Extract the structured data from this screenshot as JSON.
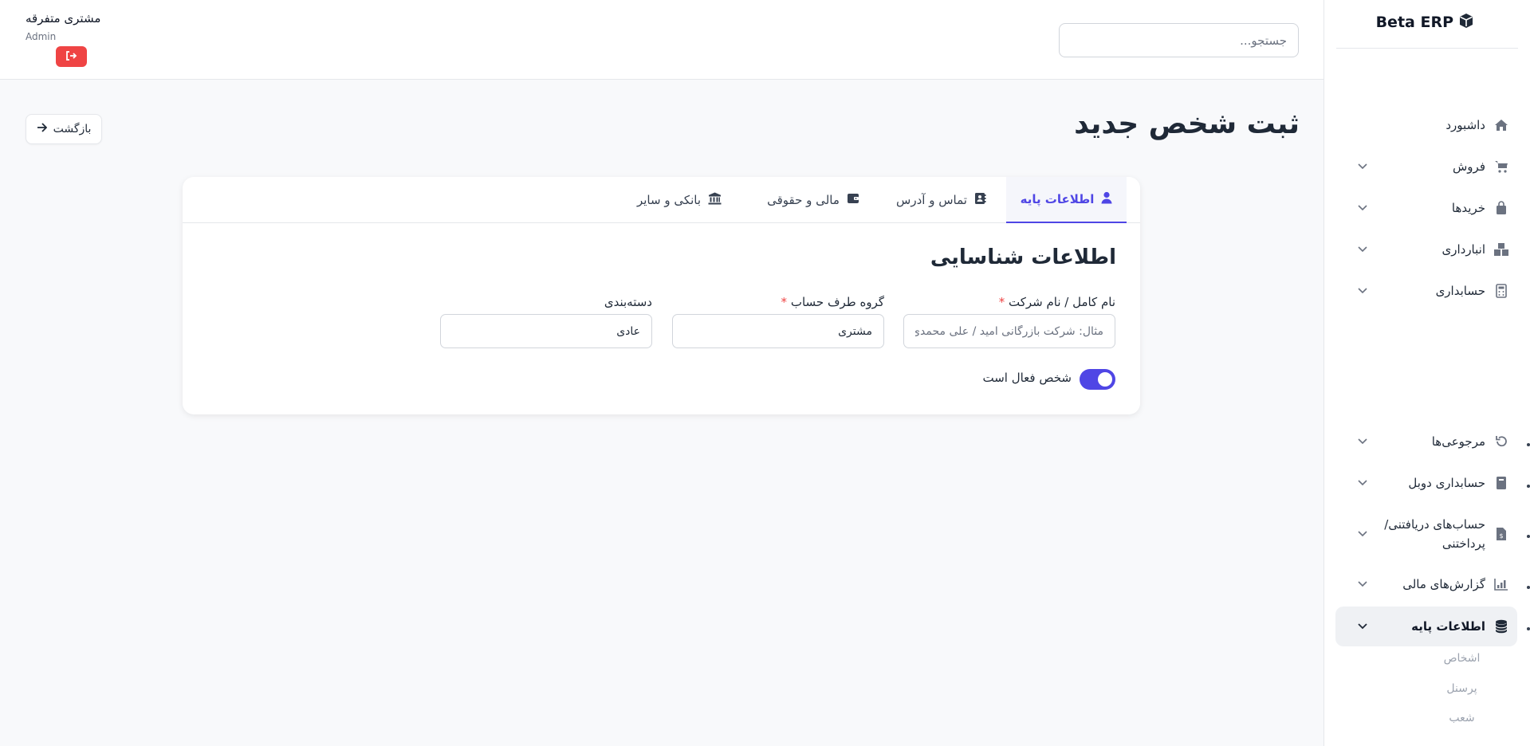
{
  "brand": {
    "name": "Beta ERP"
  },
  "sidebar": {
    "items": [
      {
        "label": "داشبورد",
        "icon": "home-icon"
      },
      {
        "label": "فروش",
        "icon": "cart-icon"
      },
      {
        "label": "خریدها",
        "icon": "bag-icon"
      },
      {
        "label": "انبارداری",
        "icon": "boxes-icon"
      },
      {
        "label": "حسابداری",
        "icon": "calculator-icon"
      },
      {
        "label": "مرجوعی‌ها",
        "icon": "undo-icon"
      },
      {
        "label": "حسابداری دوبل",
        "icon": "book-icon"
      },
      {
        "label": "حساب‌های دریافتنی/ پرداختنی",
        "icon": "invoice-icon"
      },
      {
        "label": "گزارش‌های مالی",
        "icon": "chart-icon"
      },
      {
        "label": "اطلاعات پایه",
        "icon": "database-icon"
      }
    ],
    "sub_items": [
      "اشخاص",
      "پرسنل",
      "شعب"
    ]
  },
  "header": {
    "search_placeholder": "جستجو...",
    "user_name": "مشتری متفرقه",
    "user_role": "Admin"
  },
  "page": {
    "title": "ثبت شخص جدید",
    "back_label": "بازگشت"
  },
  "tabs": [
    {
      "label": "اطلاعات پایه",
      "icon": "user-icon"
    },
    {
      "label": "تماس و آدرس",
      "icon": "contact-book-icon"
    },
    {
      "label": "مالی و حقوقی",
      "icon": "wallet-icon"
    },
    {
      "label": "بانکی و سایر",
      "icon": "bank-icon"
    }
  ],
  "form": {
    "section_title": "اطلاعات شناسایی",
    "fields": [
      {
        "label": "نام کامل / نام شرکت",
        "required": true,
        "value": "",
        "placeholder": "مثال: شرکت بازرگانی امید / علی محمدی"
      },
      {
        "label": "گروه طرف حساب",
        "required": true,
        "value": "مشتری",
        "placeholder": ""
      },
      {
        "label": "دسته‌بندی",
        "required": false,
        "value": "عادی",
        "placeholder": ""
      }
    ],
    "active_toggle": {
      "label": "شخص فعال است",
      "on": true
    }
  },
  "colors": {
    "accent": "#4f46e5",
    "danger": "#ef4444"
  }
}
